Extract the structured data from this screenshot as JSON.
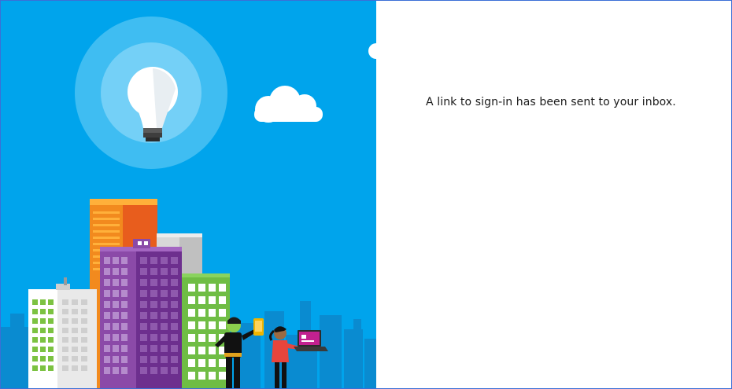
{
  "message": {
    "text": "A link to sign-in has been sent to your inbox."
  },
  "colors": {
    "hero_background": "#00a4ec",
    "content_background": "#ffffff",
    "window_border": "#3b6fd6"
  },
  "icons": {
    "lightbulb": "lightbulb-icon",
    "cloud": "cloud-icon"
  }
}
